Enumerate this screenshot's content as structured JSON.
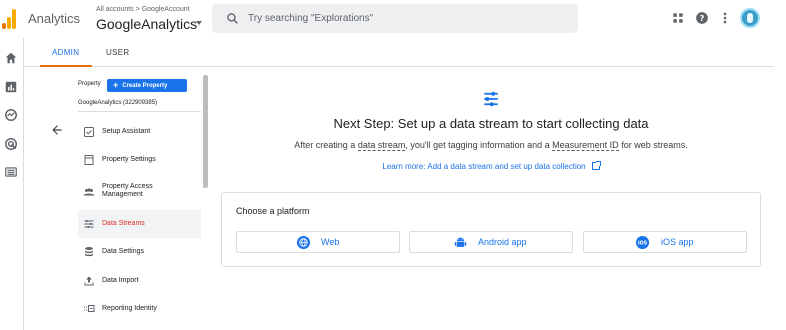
{
  "header": {
    "product_name": "Analytics",
    "breadcrumb": "All accounts > GoogleAccount",
    "account_name": "GoogleAnalytics",
    "search_placeholder": "Try searching \"Explorations\""
  },
  "icons": {
    "logo": "google-analytics-logo",
    "search": "search-icon",
    "apps": "apps-grid-icon",
    "help": "help-icon",
    "more": "more-vert-icon",
    "rail": [
      "home-icon",
      "reports-icon",
      "explore-icon",
      "advertising-icon",
      "configure-icon"
    ]
  },
  "tabs": [
    {
      "label": "ADMIN",
      "active": true
    },
    {
      "label": "USER",
      "active": false
    }
  ],
  "property": {
    "label": "Property",
    "create_button": "Create Property",
    "name": "GoogleAnalytics (322909385)"
  },
  "nav_items": [
    {
      "label": "Setup Assistant",
      "icon": "checkbox-icon",
      "active": false
    },
    {
      "label": "Property Settings",
      "icon": "document-icon",
      "active": false
    },
    {
      "label": "Property Access Management",
      "icon": "people-icon",
      "active": false
    },
    {
      "label": "Data Streams",
      "icon": "streams-icon",
      "active": true
    },
    {
      "label": "Data Settings",
      "icon": "database-icon",
      "active": false
    },
    {
      "label": "Data Import",
      "icon": "upload-icon",
      "active": false
    },
    {
      "label": "Reporting Identity",
      "icon": "reporting-identity-icon",
      "active": false
    }
  ],
  "main": {
    "heading": "Next Step: Set up a data stream to start collecting data",
    "description": {
      "part1": "After creating a ",
      "term1": "data stream",
      "part2": ", you'll get tagging information and a ",
      "term2": "Measurement ID",
      "part3": " for web streams."
    },
    "learn_more": "Learn more: Add a data stream and set up data collection",
    "choose_platform": "Choose a platform",
    "platforms": [
      {
        "label": "Web",
        "icon": "globe-icon"
      },
      {
        "label": "Android app",
        "icon": "android-icon"
      },
      {
        "label": "iOS app",
        "icon": "ios-icon"
      }
    ]
  },
  "colors": {
    "accent": "#1a73e8",
    "active_tab_underline": "#e8710a",
    "active_nav_text": "#d93025",
    "logo_orange": "#f9ab00",
    "logo_dark_orange": "#e37400"
  }
}
